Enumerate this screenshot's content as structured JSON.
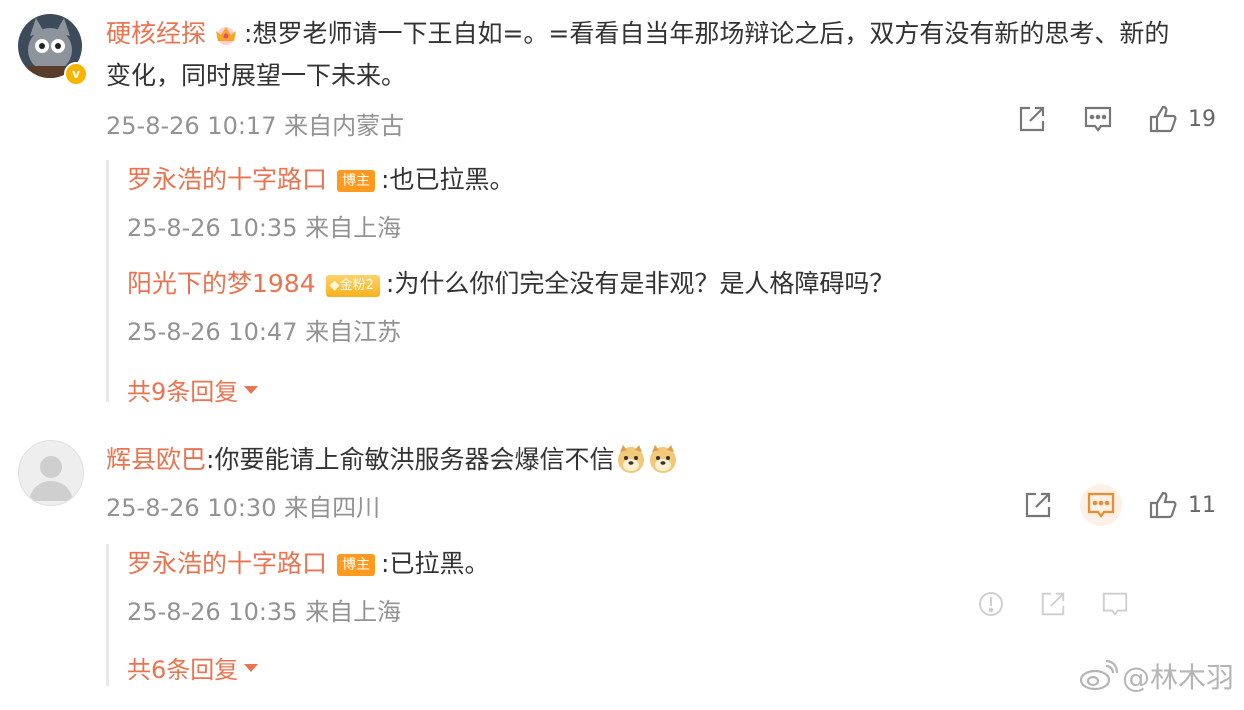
{
  "comments": [
    {
      "username": "硬核经探",
      "text": ":想罗老师请一下王自如=。=看看自当年那场辩论之后，双方有没有新的思考、新的",
      "text_line2": "变化，同时展望一下未来。",
      "time": "25-8-26 10:17",
      "location": "来自内蒙古",
      "likes": "19",
      "replies": [
        {
          "username": "罗永浩的十字路口",
          "badge": "博主",
          "text": ":也已拉黑。",
          "time": "25-8-26 10:35",
          "location": "来自上海"
        },
        {
          "username": "阳光下的梦1984",
          "badge": "金粉2",
          "text": ":为什么你们完全没有是非观？是人格障碍吗？",
          "time": "25-8-26 10:47",
          "location": "来自江苏"
        }
      ],
      "more_replies": "共9条回复"
    },
    {
      "username": "辉县欧巴",
      "text": ":你要能请上俞敏洪服务器会爆信不信",
      "time": "25-8-26 10:30",
      "location": "来自四川",
      "likes": "11",
      "replies": [
        {
          "username": "罗永浩的十字路口",
          "badge": "博主",
          "text": ":已拉黑。",
          "time": "25-8-26 10:35",
          "location": "来自上海"
        }
      ],
      "more_replies": "共6条回复"
    }
  ],
  "watermark": "@林木羽",
  "colors": {
    "username": "#eb7350",
    "meta": "#939393",
    "host_badge": "#ff9a1f",
    "verified": "#f7b500"
  },
  "icons": [
    "share-icon",
    "comment-icon",
    "like-icon",
    "report-icon",
    "crown-icon",
    "doge-emoji",
    "weibo-logo-icon"
  ]
}
